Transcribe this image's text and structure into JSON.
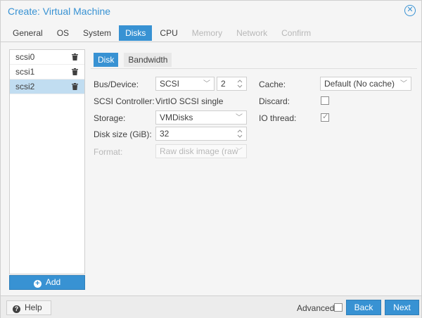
{
  "window": {
    "title": "Create: Virtual Machine",
    "close_icon": "close-icon"
  },
  "tabs": [
    {
      "label": "General",
      "state": "normal"
    },
    {
      "label": "OS",
      "state": "normal"
    },
    {
      "label": "System",
      "state": "normal"
    },
    {
      "label": "Disks",
      "state": "active"
    },
    {
      "label": "CPU",
      "state": "normal"
    },
    {
      "label": "Memory",
      "state": "disabled"
    },
    {
      "label": "Network",
      "state": "disabled"
    },
    {
      "label": "Confirm",
      "state": "disabled"
    }
  ],
  "disk_list": {
    "items": [
      {
        "label": "scsi0",
        "selected": false
      },
      {
        "label": "scsi1",
        "selected": false
      },
      {
        "label": "scsi2",
        "selected": true
      }
    ],
    "add_label": "Add"
  },
  "subtabs": [
    {
      "label": "Disk",
      "active": true
    },
    {
      "label": "Bandwidth",
      "active": false
    }
  ],
  "form": {
    "bus_device": {
      "label": "Bus/Device:",
      "bus": "SCSI",
      "device": "2"
    },
    "scsi_controller": {
      "label": "SCSI Controller:",
      "value": "VirtIO SCSI single"
    },
    "storage": {
      "label": "Storage:",
      "value": "VMDisks"
    },
    "disk_size": {
      "label": "Disk size (GiB):",
      "value": "32"
    },
    "format": {
      "label": "Format:",
      "value": "Raw disk image (raw"
    },
    "cache": {
      "label": "Cache:",
      "value": "Default (No cache)"
    },
    "discard": {
      "label": "Discard:",
      "checked": false
    },
    "io_thread": {
      "label": "IO thread:",
      "checked": true
    }
  },
  "footer": {
    "help_label": "Help",
    "advanced_label": "Advanced",
    "advanced_checked": false,
    "back_label": "Back",
    "next_label": "Next"
  },
  "colors": {
    "accent": "#3892d3",
    "selected_row": "#c1ddf1"
  }
}
